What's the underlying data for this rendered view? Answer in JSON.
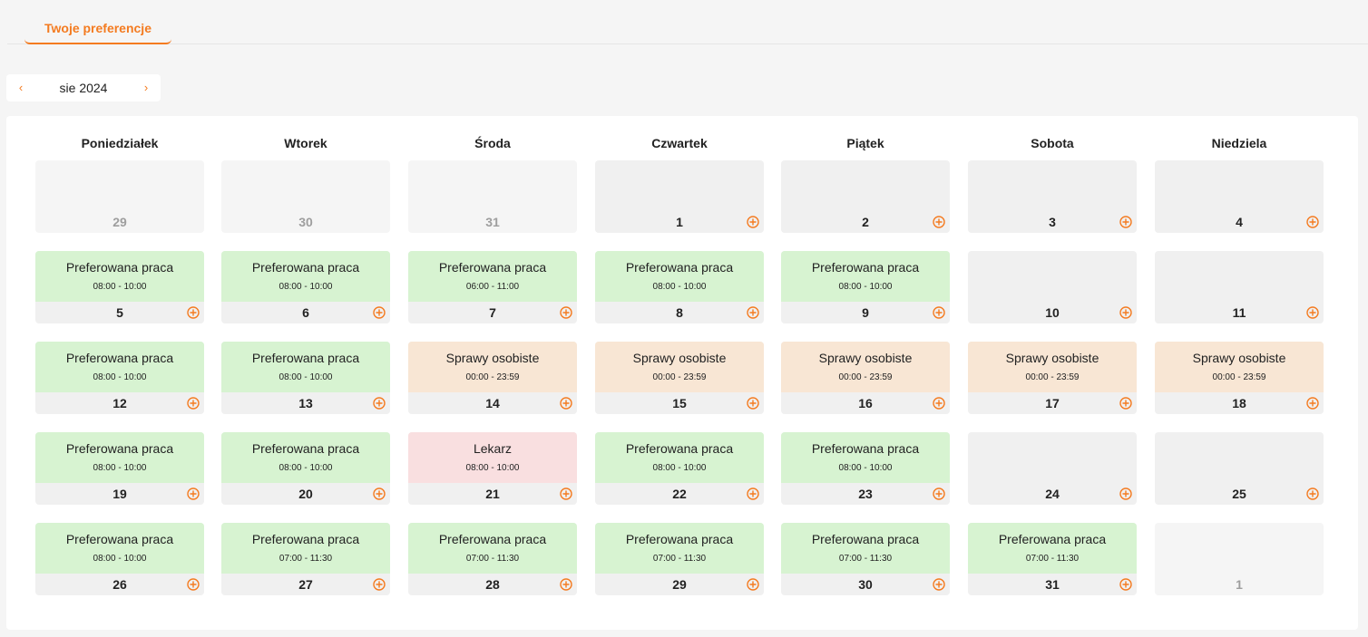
{
  "tabs": [
    {
      "label": "Twoje preferencje"
    }
  ],
  "month_nav": {
    "label": "sie 2024",
    "prev_glyph": "‹",
    "next_glyph": "›"
  },
  "accent_color": "#f47b20",
  "weekdays": [
    "Poniedziałek",
    "Wtorek",
    "Środa",
    "Czwartek",
    "Piątek",
    "Sobota",
    "Niedziela"
  ],
  "weeks": [
    [
      {
        "day": "29",
        "outside": true
      },
      {
        "day": "30",
        "outside": true
      },
      {
        "day": "31",
        "outside": true
      },
      {
        "day": "1"
      },
      {
        "day": "2"
      },
      {
        "day": "3"
      },
      {
        "day": "4"
      }
    ],
    [
      {
        "day": "5",
        "event": {
          "title": "Preferowana praca",
          "time": "08:00 - 10:00",
          "kind": "green"
        }
      },
      {
        "day": "6",
        "event": {
          "title": "Preferowana praca",
          "time": "08:00 - 10:00",
          "kind": "green"
        }
      },
      {
        "day": "7",
        "event": {
          "title": "Preferowana praca",
          "time": "06:00 - 11:00",
          "kind": "green"
        }
      },
      {
        "day": "8",
        "event": {
          "title": "Preferowana praca",
          "time": "08:00 - 10:00",
          "kind": "green"
        }
      },
      {
        "day": "9",
        "event": {
          "title": "Preferowana praca",
          "time": "08:00 - 10:00",
          "kind": "green"
        }
      },
      {
        "day": "10"
      },
      {
        "day": "11"
      }
    ],
    [
      {
        "day": "12",
        "event": {
          "title": "Preferowana praca",
          "time": "08:00 - 10:00",
          "kind": "green"
        }
      },
      {
        "day": "13",
        "event": {
          "title": "Preferowana praca",
          "time": "08:00 - 10:00",
          "kind": "green"
        }
      },
      {
        "day": "14",
        "event": {
          "title": "Sprawy osobiste",
          "time": "00:00 - 23:59",
          "kind": "orange"
        }
      },
      {
        "day": "15",
        "event": {
          "title": "Sprawy osobiste",
          "time": "00:00 - 23:59",
          "kind": "orange"
        }
      },
      {
        "day": "16",
        "event": {
          "title": "Sprawy osobiste",
          "time": "00:00 - 23:59",
          "kind": "orange"
        }
      },
      {
        "day": "17",
        "event": {
          "title": "Sprawy osobiste",
          "time": "00:00 - 23:59",
          "kind": "orange"
        }
      },
      {
        "day": "18",
        "event": {
          "title": "Sprawy osobiste",
          "time": "00:00 - 23:59",
          "kind": "orange"
        }
      }
    ],
    [
      {
        "day": "19",
        "event": {
          "title": "Preferowana praca",
          "time": "08:00 - 10:00",
          "kind": "green"
        }
      },
      {
        "day": "20",
        "event": {
          "title": "Preferowana praca",
          "time": "08:00 - 10:00",
          "kind": "green"
        }
      },
      {
        "day": "21",
        "event": {
          "title": "Lekarz",
          "time": "08:00 - 10:00",
          "kind": "red"
        }
      },
      {
        "day": "22",
        "event": {
          "title": "Preferowana praca",
          "time": "08:00 - 10:00",
          "kind": "green"
        }
      },
      {
        "day": "23",
        "event": {
          "title": "Preferowana praca",
          "time": "08:00 - 10:00",
          "kind": "green"
        }
      },
      {
        "day": "24"
      },
      {
        "day": "25"
      }
    ],
    [
      {
        "day": "26",
        "event": {
          "title": "Preferowana praca",
          "time": "08:00 - 10:00",
          "kind": "green"
        }
      },
      {
        "day": "27",
        "event": {
          "title": "Preferowana praca",
          "time": "07:00 - 11:30",
          "kind": "green"
        }
      },
      {
        "day": "28",
        "event": {
          "title": "Preferowana praca",
          "time": "07:00 - 11:30",
          "kind": "green"
        }
      },
      {
        "day": "29",
        "event": {
          "title": "Preferowana praca",
          "time": "07:00 - 11:30",
          "kind": "green"
        }
      },
      {
        "day": "30",
        "event": {
          "title": "Preferowana praca",
          "time": "07:00 - 11:30",
          "kind": "green"
        }
      },
      {
        "day": "31",
        "event": {
          "title": "Preferowana praca",
          "time": "07:00 - 11:30",
          "kind": "green"
        }
      },
      {
        "day": "1",
        "outside": true
      }
    ]
  ],
  "icons": {
    "add": "add-circle-icon",
    "prev": "chevron-left-icon",
    "next": "chevron-right-icon"
  }
}
